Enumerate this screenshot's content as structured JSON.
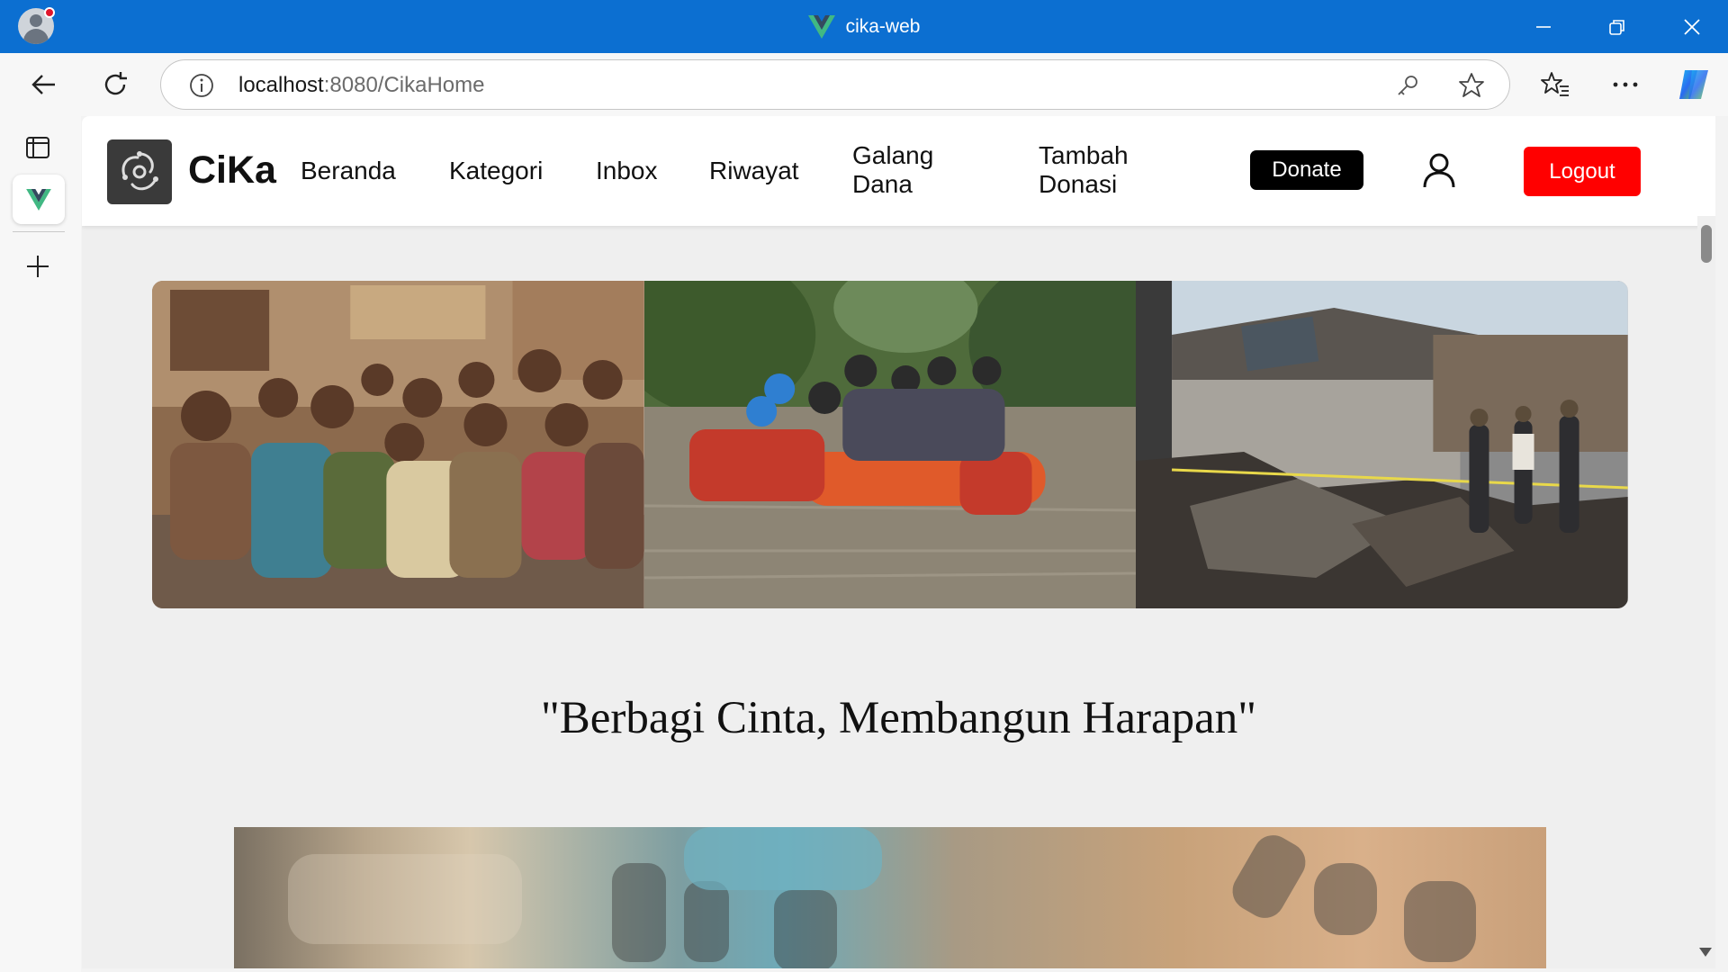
{
  "window": {
    "title": "cika-web",
    "brand_color": "#0c6fd1",
    "controls": [
      "minimize-icon",
      "restore-icon",
      "close-icon"
    ]
  },
  "browser": {
    "url_host": "localhost",
    "url_rest": ":8080/CikaHome",
    "toolbar_icons": [
      "back-icon",
      "refresh-icon",
      "info-icon",
      "key-icon",
      "star-icon",
      "favorites-icon",
      "more-icon",
      "copilot-icon"
    ]
  },
  "sidebar": {
    "icons": [
      "tab-actions-icon",
      "vue-tab-icon",
      "new-tab-icon"
    ]
  },
  "navbar": {
    "brand": "CiKa",
    "links": [
      {
        "label": "Beranda"
      },
      {
        "label": "Kategori"
      },
      {
        "label": "Inbox"
      },
      {
        "label": "Riwayat"
      },
      {
        "label": "Galang\nDana"
      },
      {
        "label": "Tambah\nDonasi"
      }
    ],
    "donate_label": "Donate",
    "logout_label": "Logout",
    "colors": {
      "donate": "#000000",
      "logout": "#ff0000"
    }
  },
  "hero": {
    "images": [
      "children-sitting-photo",
      "flood-rescue-photo",
      "fire-ruins-photo"
    ]
  },
  "tagline": "\"Berbagi Cinta, Membangun Harapan\""
}
